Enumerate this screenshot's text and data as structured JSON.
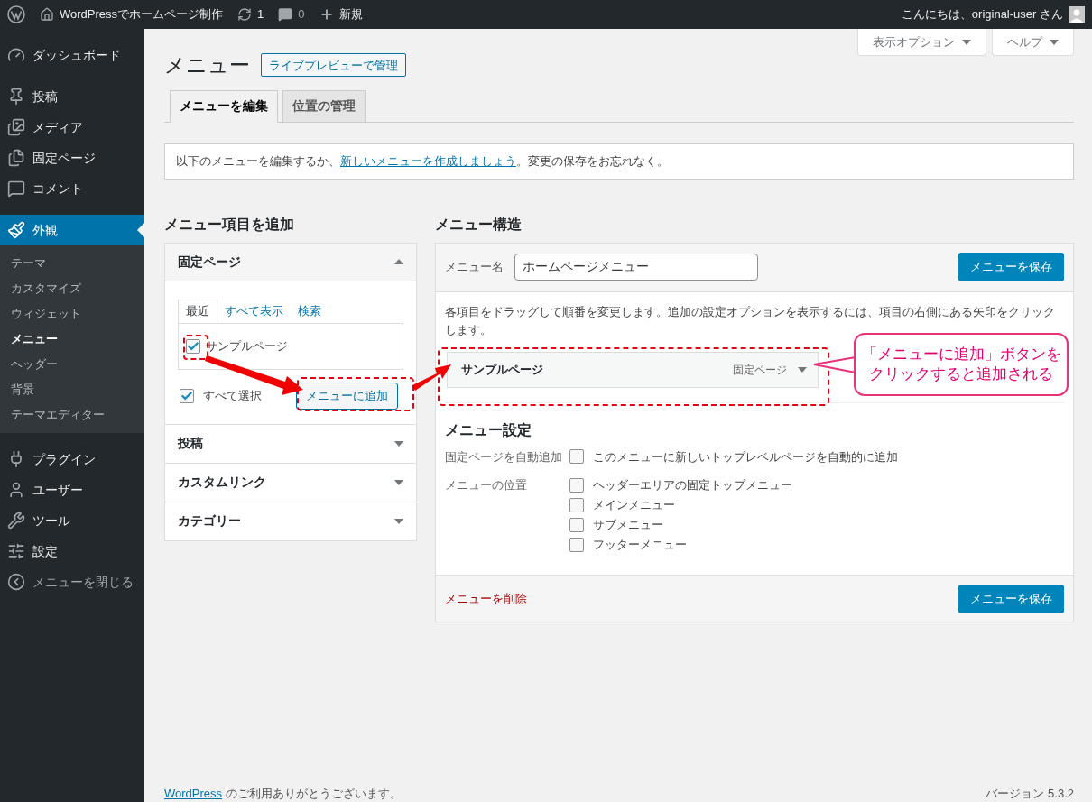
{
  "admin_bar": {
    "site_title": "WordPressでホームページ制作",
    "updates": "1",
    "comments": "0",
    "new_label": "新規",
    "greeting": "こんにちは、original-user さん"
  },
  "sidebar": {
    "items": [
      {
        "label": "ダッシュボード",
        "selected": false
      },
      {
        "label": "投稿",
        "selected": false
      },
      {
        "label": "メディア",
        "selected": false
      },
      {
        "label": "固定ページ",
        "selected": false
      },
      {
        "label": "コメント",
        "selected": false
      },
      {
        "label": "外観",
        "selected": true,
        "children": [
          {
            "label": "テーマ",
            "selected": false
          },
          {
            "label": "カスタマイズ",
            "selected": false
          },
          {
            "label": "ウィジェット",
            "selected": false
          },
          {
            "label": "メニュー",
            "selected": true
          },
          {
            "label": "ヘッダー",
            "selected": false
          },
          {
            "label": "背景",
            "selected": false
          },
          {
            "label": "テーマエディター",
            "selected": false
          }
        ]
      },
      {
        "label": "プラグイン",
        "selected": false
      },
      {
        "label": "ユーザー",
        "selected": false
      },
      {
        "label": "ツール",
        "selected": false
      },
      {
        "label": "設定",
        "selected": false
      },
      {
        "label": "メニューを閉じる",
        "selected": false
      }
    ]
  },
  "screen_meta": [
    "表示オプション",
    "ヘルプ"
  ],
  "page": {
    "title": "メニュー",
    "action": "ライブプレビューで管理"
  },
  "tabs": [
    {
      "label": "メニューを編集",
      "selected": true
    },
    {
      "label": "位置の管理",
      "selected": false
    }
  ],
  "notice": {
    "before": "以下のメニューを編集するか、",
    "link": "新しいメニューを作成しましょう",
    "after": "。変更の保存をお忘れなく。"
  },
  "add_items": {
    "heading": "メニュー項目を追加",
    "panels": [
      {
        "title": "固定ページ",
        "expanded": true,
        "tabs": [
          {
            "label": "最近",
            "selected": true
          },
          {
            "label": "すべて表示",
            "selected": false
          },
          {
            "label": "検索",
            "selected": false
          }
        ],
        "items": [
          {
            "label": "サンプルページ",
            "checked": true
          }
        ],
        "select_all": {
          "label": "すべて選択",
          "checked": true
        },
        "button": "メニューに追加"
      },
      {
        "title": "投稿",
        "expanded": false
      },
      {
        "title": "カスタムリンク",
        "expanded": false
      },
      {
        "title": "カテゴリー",
        "expanded": false
      }
    ]
  },
  "structure": {
    "heading": "メニュー構造",
    "name_label": "メニュー名",
    "name_value": "ホームページメニュー",
    "save": "メニューを保存",
    "instructions": "各項目をドラッグして順番を変更します。追加の設定オプションを表示するには、項目の右側にある矢印をクリックします。",
    "items": [
      {
        "title": "サンプルページ",
        "type": "固定ページ"
      }
    ],
    "settings": {
      "heading": "メニュー設定",
      "auto_add": {
        "label": "固定ページを自動追加",
        "option": "このメニューに新しいトップレベルページを自動的に追加",
        "checked": false
      },
      "locations": {
        "label": "メニューの位置",
        "options": [
          {
            "label": "ヘッダーエリアの固定トップメニュー",
            "checked": false
          },
          {
            "label": "メインメニュー",
            "checked": false
          },
          {
            "label": "サブメニュー",
            "checked": false
          },
          {
            "label": "フッターメニュー",
            "checked": false
          }
        ]
      }
    },
    "delete": "メニューを削除",
    "save_bottom": "メニューを保存"
  },
  "annotation": {
    "lines": [
      "「メニューに追加」ボタンを",
      "クリックすると追加される"
    ]
  },
  "footer": {
    "link": "WordPress",
    "thanks": "のご利用ありがとうございます。",
    "version": "バージョン 5.3.2"
  }
}
